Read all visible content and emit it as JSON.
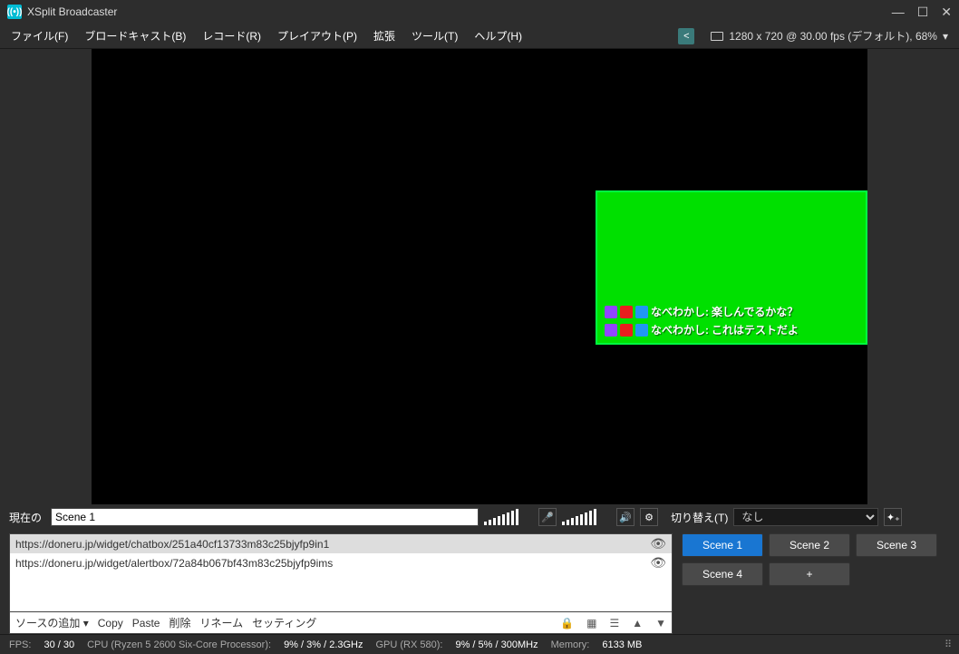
{
  "titlebar": {
    "app_name": "XSplit Broadcaster"
  },
  "menu": {
    "file": "ファイル(F)",
    "broadcast": "ブロードキャスト(B)",
    "record": "レコード(R)",
    "playout": "プレイアウト(P)",
    "ext": "拡張",
    "tools": "ツール(T)",
    "help": "ヘルプ(H)",
    "status": "1280 x 720 @ 30.00 fps (デフォルト), 68%",
    "dropdown_caret": "▾"
  },
  "overlay": {
    "line1_user": "なべわかし:",
    "line1_msg": "楽しんでるかな？",
    "line2_user": "なべわかし:",
    "line2_msg": "これはテストだよ"
  },
  "scene_row": {
    "label": "現在の",
    "scene_name": "Scene 1",
    "transition_label": "切り替え(T)",
    "transition_value": "なし"
  },
  "sources": {
    "items": [
      "https://doneru.jp/widget/chatbox/251a40cf13733m83c25bjyfp9in1",
      "https://doneru.jp/widget/alertbox/72a84b067bf43m83c25bjyfp9ims"
    ],
    "toolbar": {
      "add": "ソースの追加",
      "copy": "Copy",
      "paste": "Paste",
      "delete": "削除",
      "rename": "リネーム",
      "settings": "セッティング"
    }
  },
  "scenes": {
    "s1": "Scene 1",
    "s2": "Scene 2",
    "s3": "Scene 3",
    "s4": "Scene 4",
    "add": "+"
  },
  "status": {
    "fps_lbl": "FPS:",
    "fps_val": "30 / 30",
    "cpu_lbl": "CPU (Ryzen 5 2600 Six-Core Processor):",
    "cpu_val": "9% / 3% / 2.3GHz",
    "gpu_lbl": "GPU (RX 580):",
    "gpu_val": "9% / 5% / 300MHz",
    "mem_lbl": "Memory:",
    "mem_val": "6133 MB"
  }
}
